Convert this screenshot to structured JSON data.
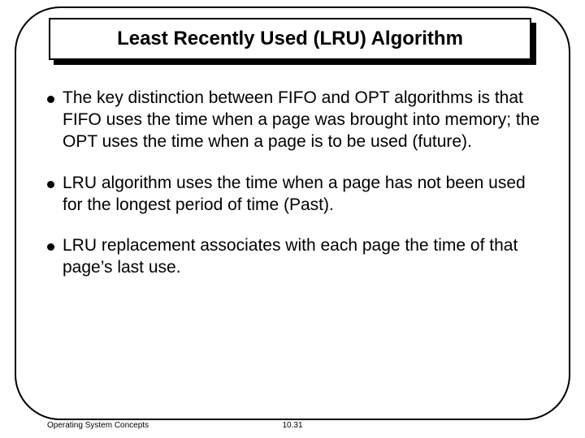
{
  "title": "Least Recently Used (LRU) Algorithm",
  "bullets": [
    "The key distinction between FIFO and OPT algorithms is that FIFO uses the time when a page was brought into memory; the OPT uses the time when a page is to be used (future).",
    "LRU algorithm uses the time when a page has not been used for the longest period of time (Past).",
    "LRU replacement associates with each page the time of that page’s last use."
  ],
  "footer": {
    "left": "Operating System Concepts",
    "center": "10.31"
  }
}
